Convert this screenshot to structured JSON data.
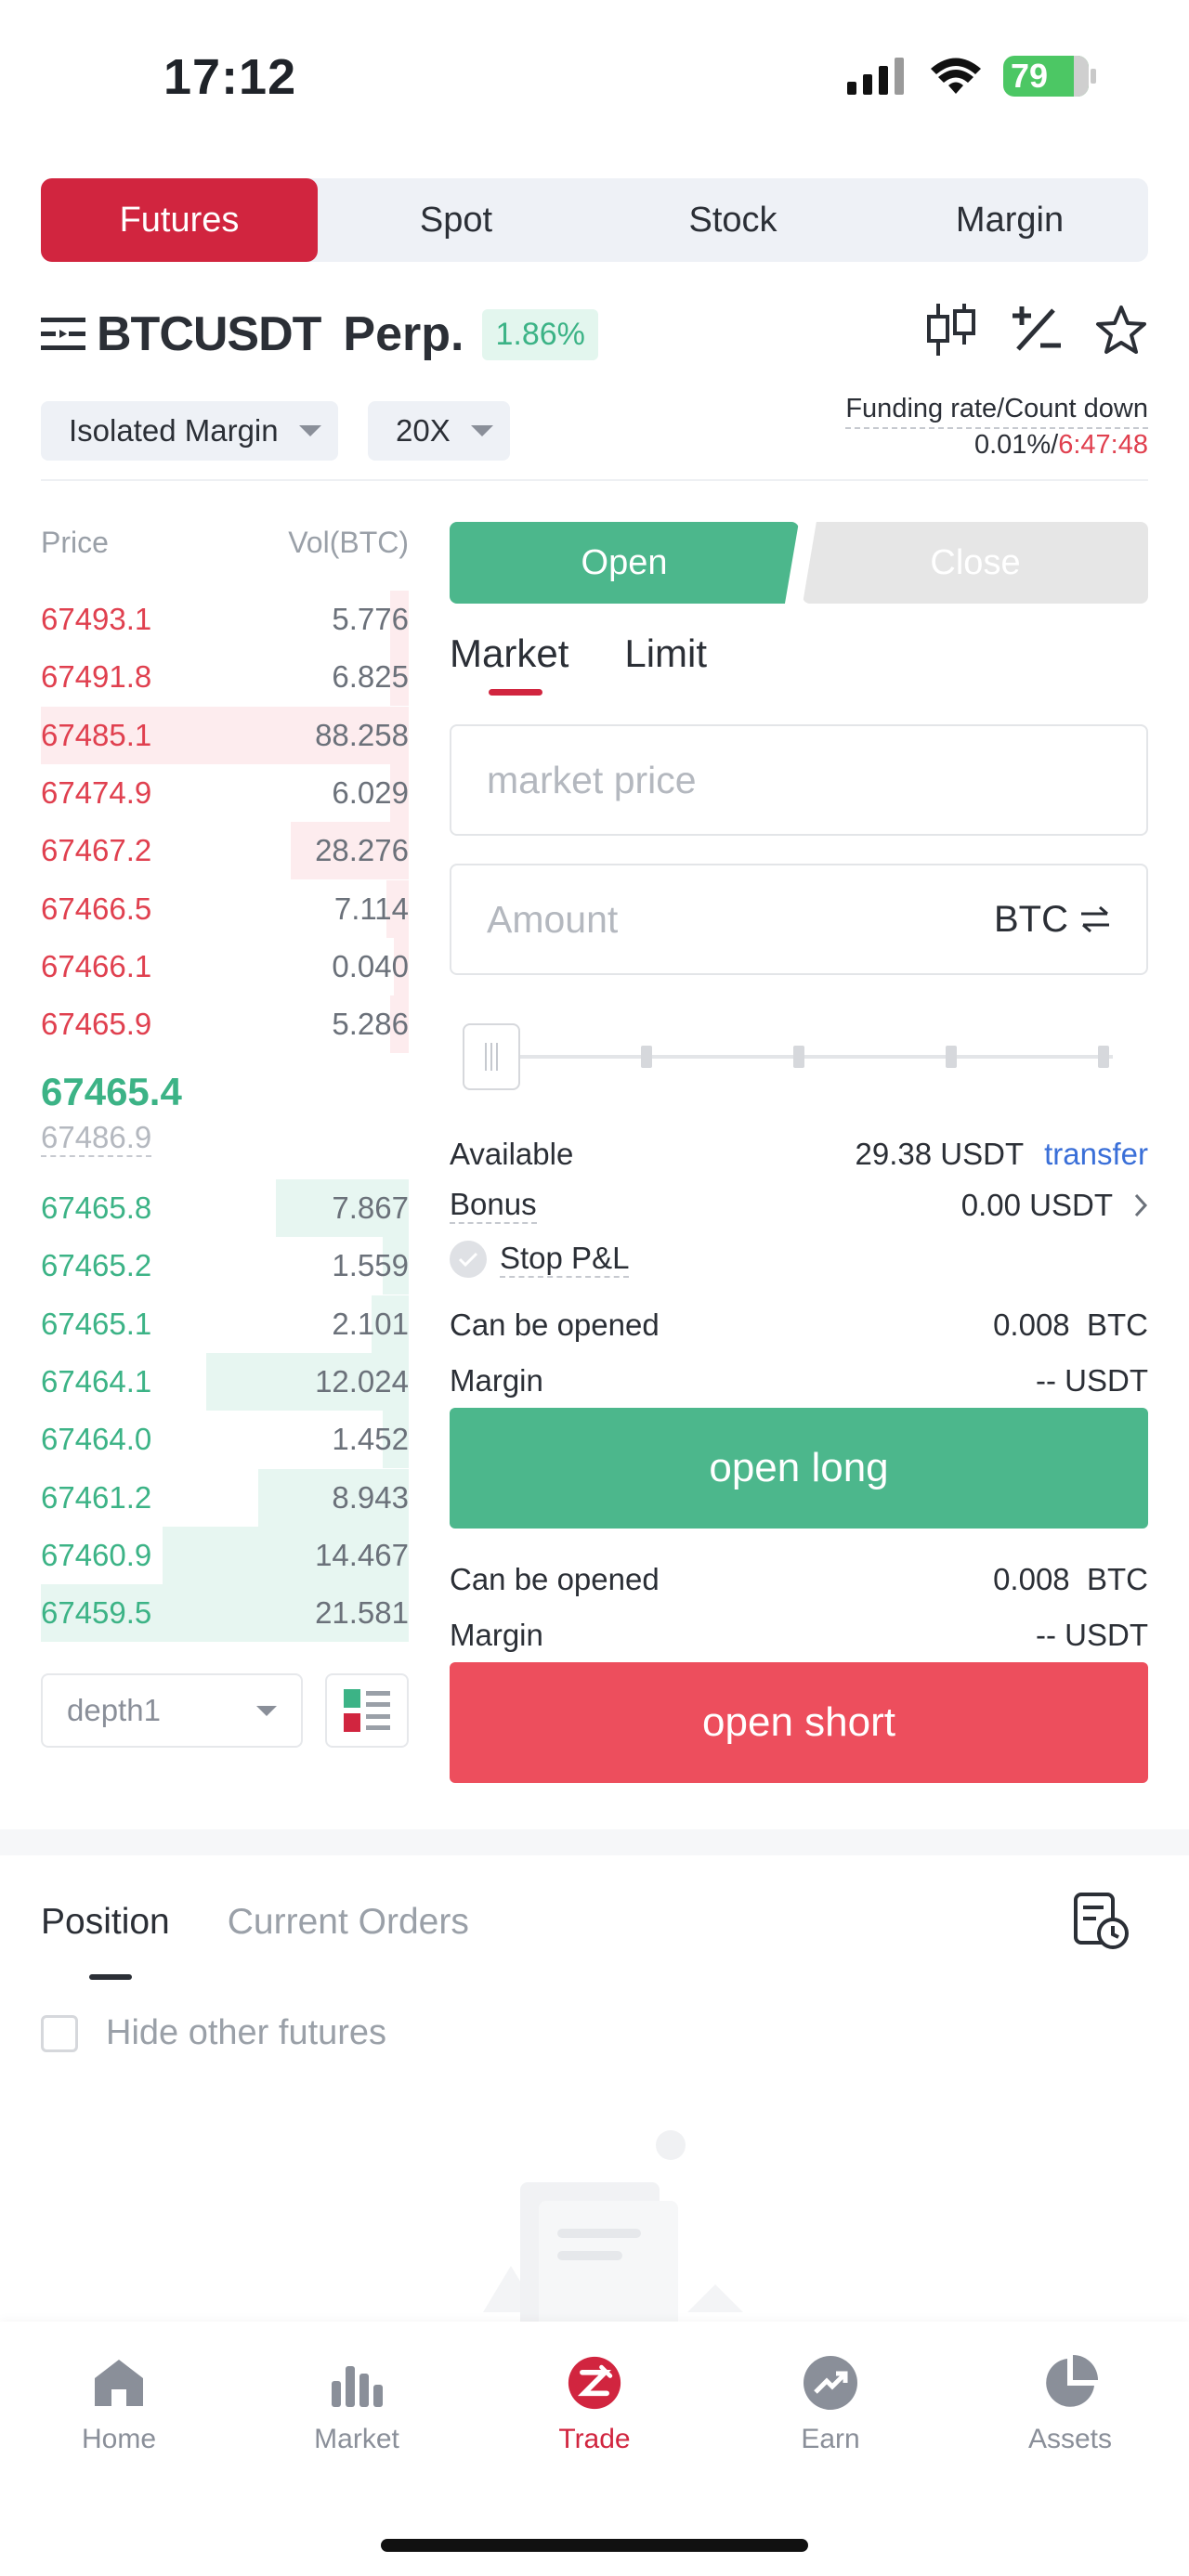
{
  "status": {
    "time": "17:12",
    "battery": "79"
  },
  "mode_tabs": [
    {
      "label": "Futures",
      "active": true
    },
    {
      "label": "Spot"
    },
    {
      "label": "Stock"
    },
    {
      "label": "Margin"
    }
  ],
  "pair": {
    "symbol": "BTCUSDT",
    "type": "Perp.",
    "change": "1.86%"
  },
  "margin_mode": "Isolated Margin",
  "leverage": "20X",
  "funding": {
    "label": "Funding rate/Count down",
    "rate": "0.01%/",
    "countdown": "6:47:48"
  },
  "orderbook": {
    "price_header": "Price",
    "vol_header": "Vol(BTC)",
    "asks": [
      {
        "price": "67493.1",
        "vol": "5.776",
        "depth": 0.05
      },
      {
        "price": "67491.8",
        "vol": "6.825",
        "depth": 0.05
      },
      {
        "price": "67485.1",
        "vol": "88.258",
        "depth": 1.0
      },
      {
        "price": "67474.9",
        "vol": "6.029",
        "depth": 0.05
      },
      {
        "price": "67467.2",
        "vol": "28.276",
        "depth": 0.32
      },
      {
        "price": "67466.5",
        "vol": "7.114",
        "depth": 0.06
      },
      {
        "price": "67466.1",
        "vol": "0.040",
        "depth": 0.04
      },
      {
        "price": "67465.9",
        "vol": "5.286",
        "depth": 0.05
      }
    ],
    "last_price": "67465.4",
    "mark_price": "67486.9",
    "bids": [
      {
        "price": "67465.8",
        "vol": "7.867",
        "depth": 0.36
      },
      {
        "price": "67465.2",
        "vol": "1.559",
        "depth": 0.07
      },
      {
        "price": "67465.1",
        "vol": "2.101",
        "depth": 0.1
      },
      {
        "price": "67464.1",
        "vol": "12.024",
        "depth": 0.55
      },
      {
        "price": "67464.0",
        "vol": "1.452",
        "depth": 0.07
      },
      {
        "price": "67461.2",
        "vol": "8.943",
        "depth": 0.41
      },
      {
        "price": "67460.9",
        "vol": "14.467",
        "depth": 0.67
      },
      {
        "price": "67459.5",
        "vol": "21.581",
        "depth": 1.0
      }
    ],
    "depth_select": "depth1"
  },
  "trade": {
    "open_label": "Open",
    "close_label": "Close",
    "order_types": [
      "Market",
      "Limit"
    ],
    "price_placeholder": "market price",
    "amount_placeholder": "Amount",
    "amount_unit": "BTC",
    "available_label": "Available",
    "available_value": "29.38 USDT",
    "transfer_label": "transfer",
    "bonus_label": "Bonus",
    "bonus_value": "0.00 USDT",
    "stop_pl_label": "Stop P&L",
    "long": {
      "can_open_label": "Can be opened",
      "can_open_value": "0.008  BTC",
      "margin_label": "Margin",
      "margin_value": "-- USDT",
      "button": "open long"
    },
    "short": {
      "can_open_label": "Can be opened",
      "can_open_value": "0.008  BTC",
      "margin_label": "Margin",
      "margin_value": "-- USDT",
      "button": "open short"
    }
  },
  "positions": {
    "tabs": [
      "Position",
      "Current Orders"
    ],
    "hide_label": "Hide other futures"
  },
  "nav": [
    {
      "label": "Home",
      "icon": "home-icon"
    },
    {
      "label": "Market",
      "icon": "market-icon"
    },
    {
      "label": "Trade",
      "icon": "trade-icon",
      "active": true
    },
    {
      "label": "Earn",
      "icon": "earn-icon"
    },
    {
      "label": "Assets",
      "icon": "assets-icon"
    }
  ],
  "colors": {
    "brand_red": "#d1253f",
    "green": "#3cb386",
    "ask_red": "#e0404f",
    "link": "#3a6fd8"
  }
}
